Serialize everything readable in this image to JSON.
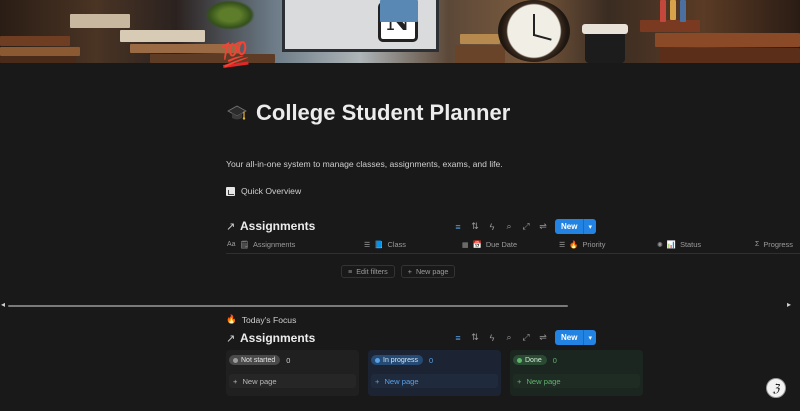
{
  "page": {
    "title": "College Student Planner",
    "icon": "hundred-points-emoji",
    "icon_text": "💯",
    "description": "Your all-in-one system to manage classes, assignments, exams, and life.",
    "quick_overview": "Quick Overview",
    "todays_focus": "Today's Focus"
  },
  "assignments_table": {
    "title": "Assignments",
    "new_label": "New",
    "columns": [
      {
        "label": "Assignments",
        "icon": "text-icon"
      },
      {
        "label": "Class",
        "icon": "list-icon"
      },
      {
        "label": "Due Date",
        "icon": "calendar-icon"
      },
      {
        "label": "Priority",
        "icon": "list-icon"
      },
      {
        "label": "Status",
        "icon": "status-icon"
      },
      {
        "label": "Progress",
        "icon": "sigma-icon"
      }
    ],
    "edit_filters": "Edit filters",
    "new_page": "New page"
  },
  "assignments_board": {
    "title": "Assignments",
    "new_label": "New",
    "groups": [
      {
        "label": "Not started",
        "count": "0",
        "new_page": "New page"
      },
      {
        "label": "In progress",
        "count": "0",
        "new_page": "New page"
      },
      {
        "label": "Done",
        "count": "0",
        "new_page": "New page"
      }
    ]
  },
  "colors": {
    "background": "#191919",
    "accent": "#2383e2",
    "in_progress": "#5aa0e6",
    "done": "#62b26f"
  }
}
